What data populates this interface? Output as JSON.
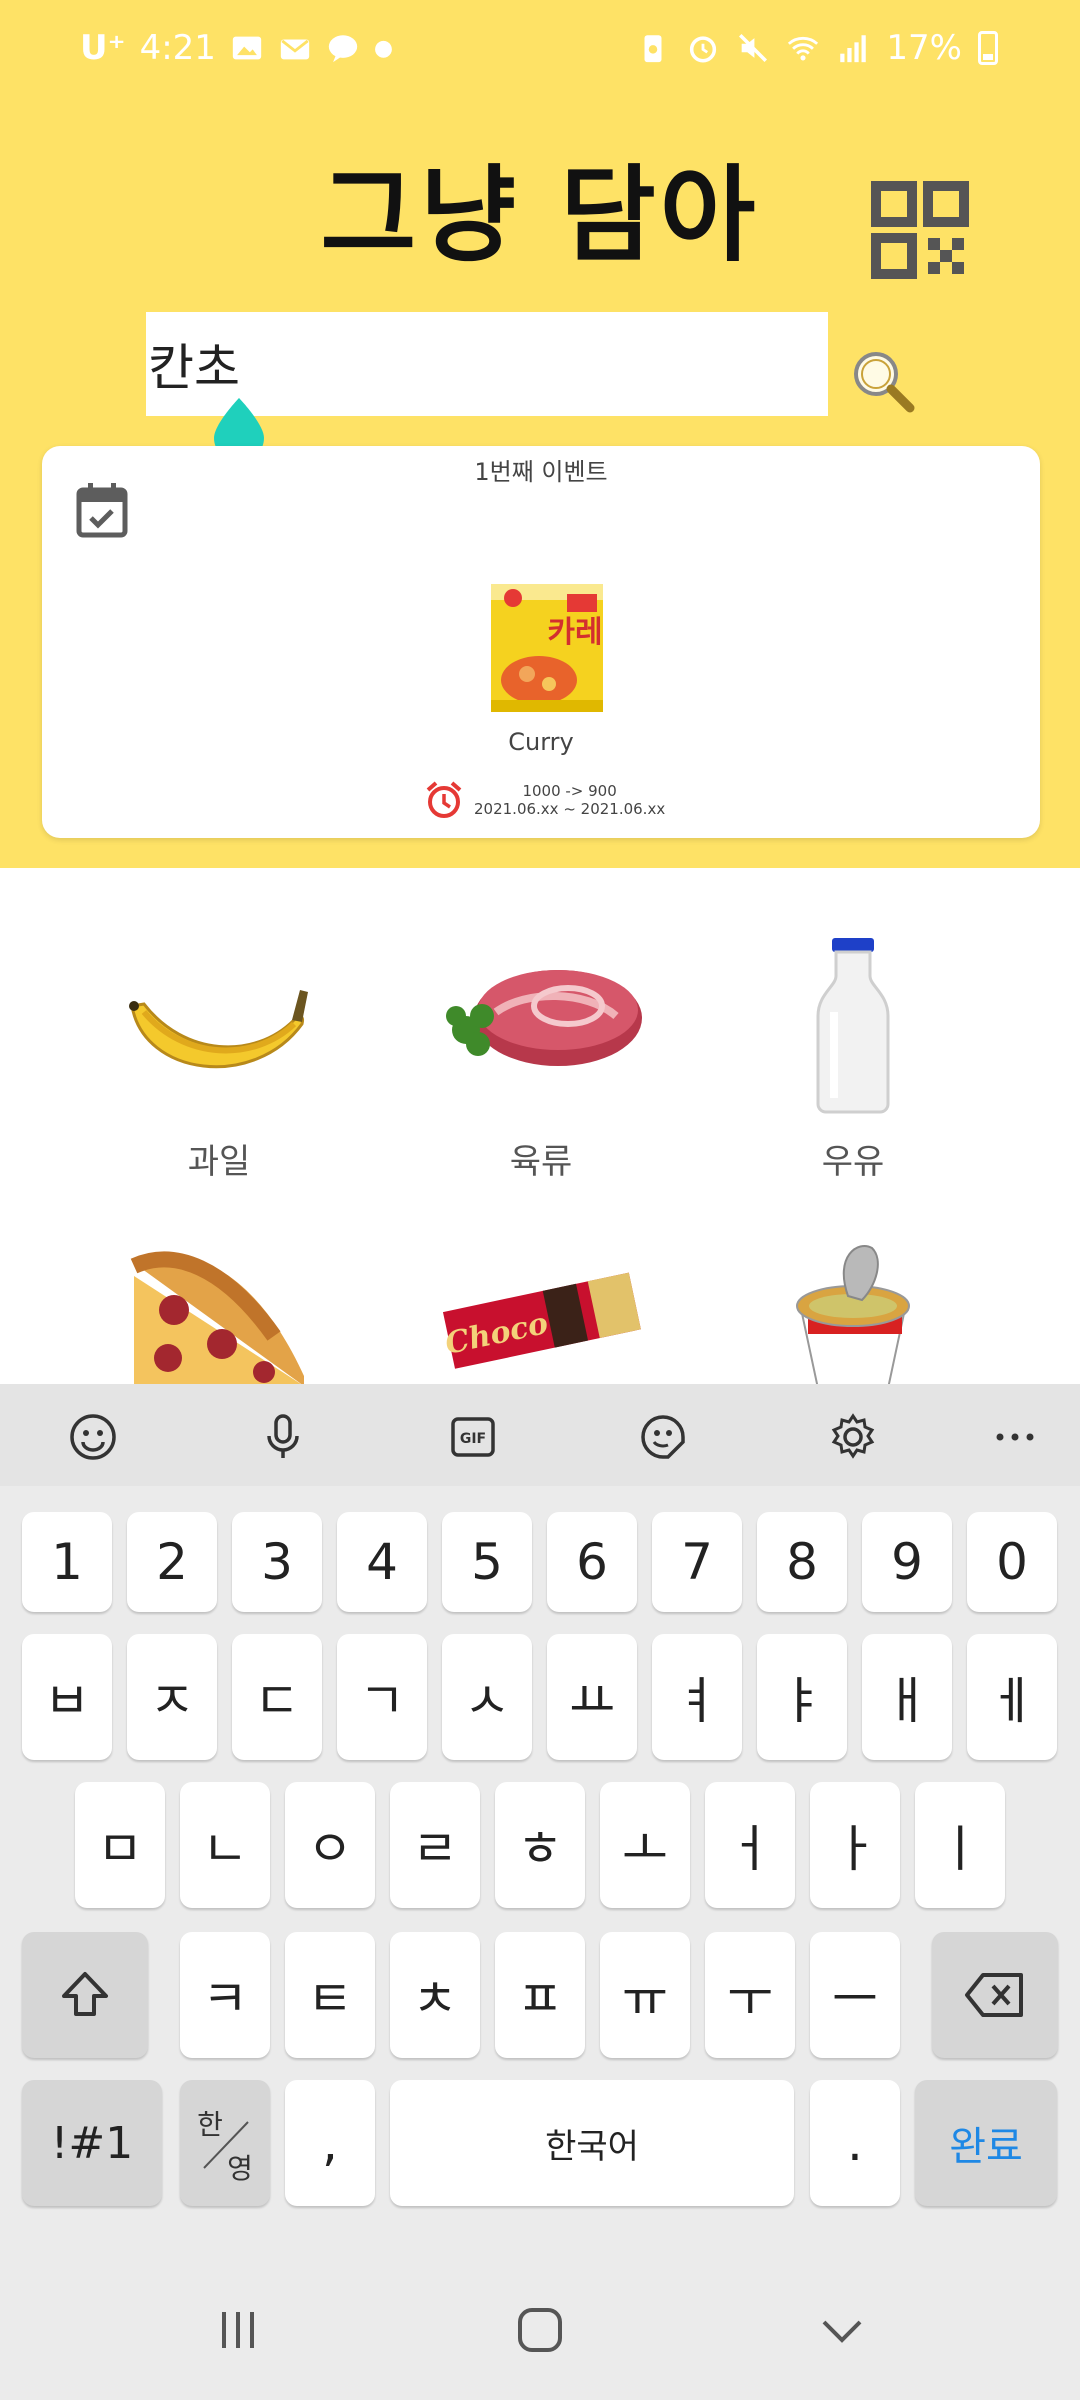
{
  "status_bar": {
    "carrier": "U⁺",
    "time": "4:21",
    "battery": "17%"
  },
  "app": {
    "title": "그냥 담아"
  },
  "search": {
    "value": "칸초"
  },
  "event": {
    "title": "1번째 이벤트",
    "product_name": "Curry",
    "product_package_text": "카레",
    "price_change": "1000 -> 900",
    "period": "2021.06.xx ~ 2021.06.xx"
  },
  "categories": [
    {
      "label": "과일",
      "icon": "banana"
    },
    {
      "label": "육류",
      "icon": "meat"
    },
    {
      "label": "우유",
      "icon": "milk-bottle"
    },
    {
      "label": "",
      "icon": "pizza"
    },
    {
      "label": "",
      "icon": "chocolate-bar"
    },
    {
      "label": "",
      "icon": "cup-noodle"
    }
  ],
  "snack_wrapper_text": "Choco",
  "keyboard": {
    "toolbar": [
      "emoji-icon",
      "mic-icon",
      "gif-icon",
      "sticker-icon",
      "settings-icon",
      "more-icon"
    ],
    "row_numbers": [
      "1",
      "2",
      "3",
      "4",
      "5",
      "6",
      "7",
      "8",
      "9",
      "0"
    ],
    "row1": [
      "ㅂ",
      "ㅈ",
      "ㄷ",
      "ㄱ",
      "ㅅ",
      "ㅛ",
      "ㅕ",
      "ㅑ",
      "ㅐ",
      "ㅔ"
    ],
    "row2": [
      "ㅁ",
      "ㄴ",
      "ㅇ",
      "ㄹ",
      "ㅎ",
      "ㅗ",
      "ㅓ",
      "ㅏ",
      "ㅣ"
    ],
    "row3": [
      "ㅋ",
      "ㅌ",
      "ㅊ",
      "ㅍ",
      "ㅠ",
      "ㅜ",
      "ㅡ"
    ],
    "symbols_label": "!#1",
    "lang_top": "한",
    "lang_bottom": "영",
    "comma": ",",
    "space_label": "한국어",
    "period": ".",
    "done_label": "완료"
  },
  "colors": {
    "header_bg": "#fee266",
    "accent_blue": "#1e88e5",
    "cursor_handle": "#1fd0bc",
    "alarm_red": "#e53935"
  }
}
